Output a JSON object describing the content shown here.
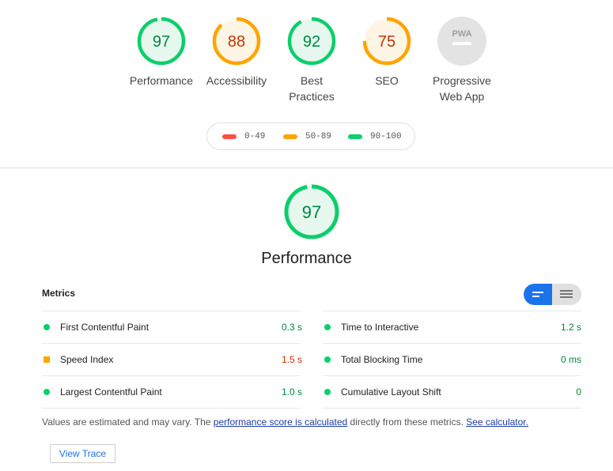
{
  "colors": {
    "pass": "#0cce6b",
    "average": "#ffa400",
    "fail": "#ff4e42",
    "pass_text": "#018642",
    "average_text": "#c33300",
    "pwa": "#9e9e9e",
    "link": "#1a3fa0",
    "toggle_active": "#1a73e8"
  },
  "categories": [
    {
      "score": "97",
      "label": "Performance",
      "status": "pass",
      "fraction": 0.97
    },
    {
      "score": "88",
      "label": "Accessibility",
      "status": "average",
      "fraction": 0.88
    },
    {
      "score": "92",
      "label": "Best Practices",
      "status": "pass",
      "fraction": 0.92
    },
    {
      "score": "75",
      "label": "SEO",
      "status": "average",
      "fraction": 0.75
    },
    {
      "badge": "PWA",
      "label": "Progressive Web App",
      "status": "pwa"
    }
  ],
  "legend": [
    {
      "range": "0-49",
      "status": "fail"
    },
    {
      "range": "50-89",
      "status": "average"
    },
    {
      "range": "90-100",
      "status": "pass"
    }
  ],
  "performance": {
    "score": "97",
    "title": "Performance",
    "fraction": 0.97
  },
  "metrics": {
    "header": "Metrics",
    "items": [
      {
        "name": "First Contentful Paint",
        "value": "0.3 s",
        "status": "pass"
      },
      {
        "name": "Time to Interactive",
        "value": "1.2 s",
        "status": "pass"
      },
      {
        "name": "Speed Index",
        "value": "1.5 s",
        "status": "average"
      },
      {
        "name": "Total Blocking Time",
        "value": "0 ms",
        "status": "pass"
      },
      {
        "name": "Largest Contentful Paint",
        "value": "1.0 s",
        "status": "pass"
      },
      {
        "name": "Cumulative Layout Shift",
        "value": "0",
        "status": "pass"
      }
    ]
  },
  "note": {
    "prefix": "Values are estimated and may vary. The ",
    "link1": "performance score is calculated",
    "middle": " directly from these metrics. ",
    "link2": "See calculator."
  },
  "buttons": {
    "view_trace": "View Trace"
  }
}
